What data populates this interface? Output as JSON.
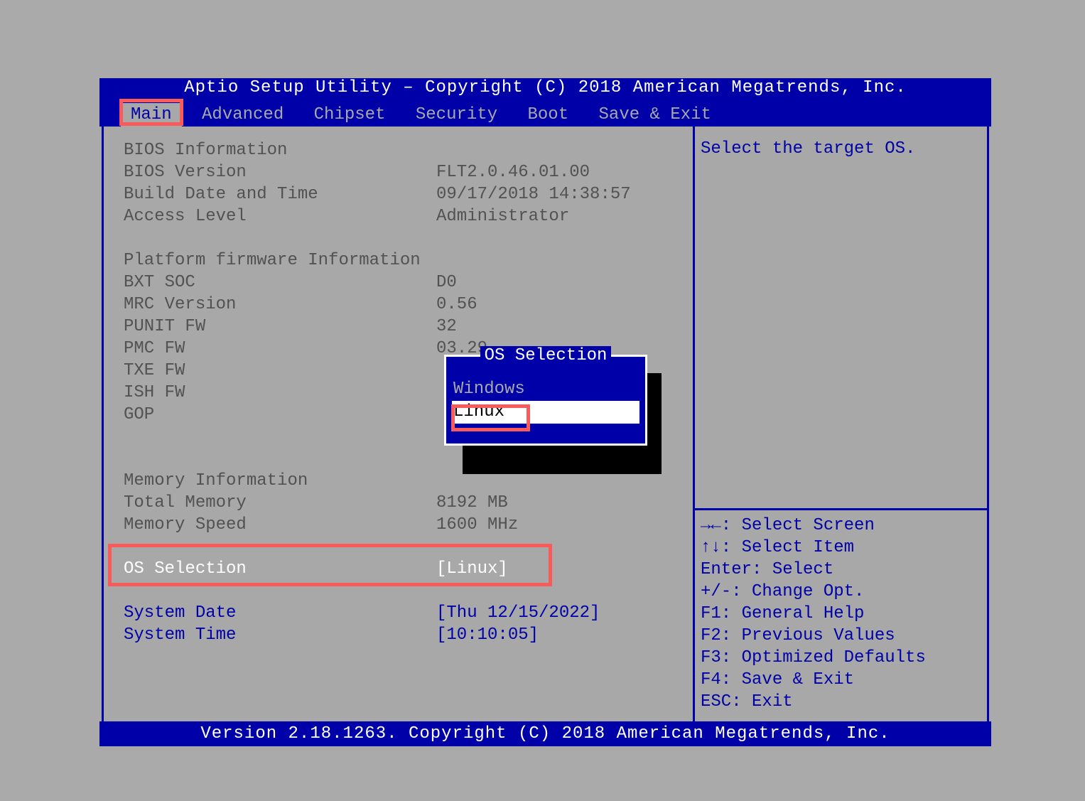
{
  "header_title": "Aptio Setup Utility – Copyright (C) 2018 American Megatrends, Inc.",
  "footer_text": "Version 2.18.1263. Copyright (C) 2018 American Megatrends, Inc.",
  "tabs": {
    "main": "Main",
    "advanced": "Advanced",
    "chipset": "Chipset",
    "security": "Security",
    "boot": "Boot",
    "save_exit": "Save & Exit"
  },
  "bios_info": {
    "section": "BIOS Information",
    "version_label": "BIOS Version",
    "version_value": "FLT2.0.46.01.00",
    "build_label": "Build Date and Time",
    "build_value": "09/17/2018 14:38:57",
    "access_label": "Access Level",
    "access_value": "Administrator"
  },
  "platform": {
    "section": "Platform firmware Information",
    "bxt_label": "BXT SOC",
    "bxt_value": "D0",
    "mrc_label": "MRC Version",
    "mrc_value": "0.56",
    "punit_label": "PUNIT FW",
    "punit_value": "32",
    "pmc_label": "PMC FW",
    "pmc_value": "03.29",
    "txe_label": "TXE FW",
    "ish_label": "ISH FW",
    "gop_label": "GOP"
  },
  "memory": {
    "section": "Memory Information",
    "total_label": "Total Memory",
    "total_value": "8192 MB",
    "speed_label": "Memory Speed",
    "speed_value": "1600 MHz"
  },
  "os_sel": {
    "label": "OS Selection",
    "value": "[Linux]"
  },
  "sysdate": {
    "label": "System Date",
    "value": "[Thu 12/15/2022]"
  },
  "systime": {
    "label": "System Time",
    "value": "[10:10:05]"
  },
  "help_text": "Select the target OS.",
  "keys": {
    "k1": "→←: Select Screen",
    "k2": "↑↓: Select Item",
    "k3": "Enter: Select",
    "k4": "+/-: Change Opt.",
    "k5": "F1: General Help",
    "k6": "F2: Previous Values",
    "k7": "F3: Optimized Defaults",
    "k8": "F4: Save & Exit",
    "k9": "ESC: Exit"
  },
  "popup": {
    "title": "OS Selection",
    "opt_windows": "Windows",
    "opt_linux": "Linux"
  }
}
